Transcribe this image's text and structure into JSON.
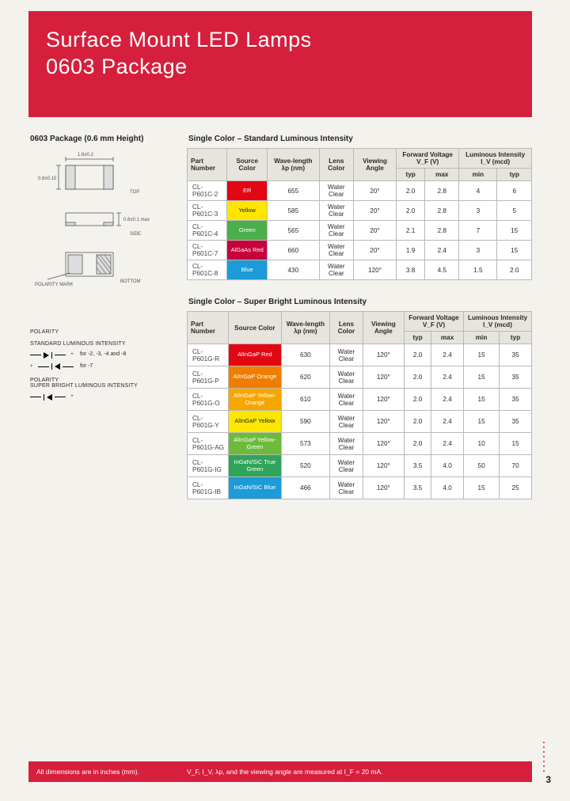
{
  "header": {
    "title_l1": "Surface Mount LED Lamps",
    "title_l2": "0603 Package"
  },
  "left": {
    "section_title": "0603 Package (0.6 mm Height)",
    "diagram": {
      "dim_x": "1.6±0.2",
      "dim_y": "0.8±0.15",
      "top_label": "TOP",
      "side_h": "0.6±0.1 max",
      "side_label": "SIDE",
      "polarity_mark": "POLARITY MARK",
      "bottom_label": "BOTTOM"
    },
    "polarity": {
      "heading": "POLARITY",
      "std_label": "STANDARD LUMINOUS INTENSITY",
      "std_note": "for -2, -3, -4 and -8",
      "std_note2": "for -7",
      "sb_label": "SUPER BRIGHT LUMINOUS INTENSITY"
    }
  },
  "tables": {
    "std_title": "Single Color – Standard Luminous Intensity",
    "sb_title": "Single Color – Super Bright Luminous Intensity",
    "head": {
      "part": "Part Number",
      "source": "Source Color",
      "wave": "Wave-length λp (nm)",
      "lens": "Lens Color",
      "angle": "Viewing Angle",
      "vf": "Forward Voltage V_F (V)",
      "typ": "typ",
      "max": "max",
      "iv": "Luminous Intensity I_V (mcd)",
      "min": "min"
    },
    "std_rows": [
      {
        "pn": "CL-P601C-2",
        "color": "ER",
        "cc": "c-red",
        "wl": "655",
        "lens": "Water Clear",
        "va": "20°",
        "vft": "2.0",
        "vfm": "2.8",
        "ivm": "4",
        "ivt": "6"
      },
      {
        "pn": "CL-P601C-3",
        "color": "Yellow",
        "cc": "c-yel",
        "wl": "585",
        "lens": "Water Clear",
        "va": "20°",
        "vft": "2.0",
        "vfm": "2.8",
        "ivm": "3",
        "ivt": "5"
      },
      {
        "pn": "CL-P601C-4",
        "color": "Green",
        "cc": "c-grn",
        "wl": "565",
        "lens": "Water Clear",
        "va": "20°",
        "vft": "2.1",
        "vfm": "2.8",
        "ivm": "7",
        "ivt": "15"
      },
      {
        "pn": "CL-P601C-7",
        "color": "AlGaAs Red",
        "cc": "c-algar",
        "wl": "660",
        "lens": "Water Clear",
        "va": "20°",
        "vft": "1.9",
        "vfm": "2.4",
        "ivm": "3",
        "ivt": "15"
      },
      {
        "pn": "CL-P601C-8",
        "color": "Blue",
        "cc": "c-blue",
        "wl": "430",
        "lens": "Water Clear",
        "va": "120°",
        "vft": "3.8",
        "vfm": "4.5",
        "ivm": "1.5",
        "ivt": "2.0"
      }
    ],
    "sb_rows": [
      {
        "pn": "CL-P601G-R",
        "color": "AlInGaP Red",
        "cc": "c-ared",
        "wl": "630",
        "lens": "Water Clear",
        "va": "120°",
        "vft": "2.0",
        "vfm": "2.4",
        "ivm": "15",
        "ivt": "35"
      },
      {
        "pn": "CL-P601G-P",
        "color": "AlInGaP Orange",
        "cc": "c-aorg",
        "wl": "620",
        "lens": "Water Clear",
        "va": "120°",
        "vft": "2.0",
        "vfm": "2.4",
        "ivm": "15",
        "ivt": "35"
      },
      {
        "pn": "CL-P601G-O",
        "color": "AlInGaP Yellow-Orange",
        "cc": "c-ayorg",
        "wl": "610",
        "lens": "Water Clear",
        "va": "120°",
        "vft": "2.0",
        "vfm": "2.4",
        "ivm": "15",
        "ivt": "35"
      },
      {
        "pn": "CL-P601G-Y",
        "color": "AlInGaP Yellow",
        "cc": "c-ayel",
        "wl": "590",
        "lens": "Water Clear",
        "va": "120°",
        "vft": "2.0",
        "vfm": "2.4",
        "ivm": "15",
        "ivt": "35"
      },
      {
        "pn": "CL-P601G-AG",
        "color": "AlInGaP Yellow-Green",
        "cc": "c-aygrn",
        "wl": "573",
        "lens": "Water Clear",
        "va": "120°",
        "vft": "2.0",
        "vfm": "2.4",
        "ivm": "10",
        "ivt": "15"
      },
      {
        "pn": "CL-P601G-IG",
        "color": "InGaN/SiC True Green",
        "cc": "c-iggn",
        "wl": "520",
        "lens": "Water Clear",
        "va": "120°",
        "vft": "3.5",
        "vfm": "4.0",
        "ivm": "50",
        "ivt": "70"
      },
      {
        "pn": "CL-P601G-IB",
        "color": "InGaN/SiC Blue",
        "cc": "c-igbl",
        "wl": "466",
        "lens": "Water Clear",
        "va": "120°",
        "vft": "3.5",
        "vfm": "4.0",
        "ivm": "15",
        "ivt": "25"
      }
    ]
  },
  "footer": {
    "note1": "All dimensions are in inches (mm).",
    "note2": "V_F, I_V, λp, and the viewing angle are measured at I_F = 20 mA.",
    "page": "3"
  }
}
